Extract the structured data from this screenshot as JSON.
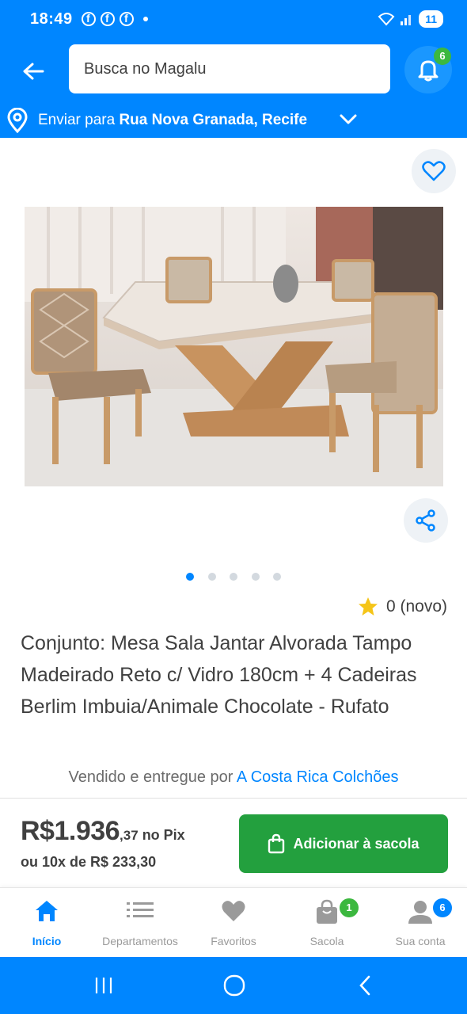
{
  "status_bar": {
    "time": "18:49",
    "battery_level": "11"
  },
  "header": {
    "search_placeholder": "Busca no Magalu",
    "notification_count": "6"
  },
  "address": {
    "prefix": "Enviar para ",
    "location": "Rua Nova Granada, Recife"
  },
  "product": {
    "carousel": {
      "total": 5,
      "active_index": 0
    },
    "rating_text": "0 (novo)",
    "title": "Conjunto: Mesa Sala Jantar Alvorada Tampo Madeirado Reto c/ Vidro 180cm + 4 Cadeiras Berlim Imbuia/Animale Chocolate - Rufato",
    "seller_prefix": "Vendido e entregue por ",
    "seller_name": "A Costa Rica Colchões"
  },
  "price": {
    "main": "R$1.936",
    "cents": ",37",
    "method": " no Pix",
    "installments": "ou 10x de R$ 233,30"
  },
  "cta": {
    "label": "Adicionar à sacola"
  },
  "bottom_nav": {
    "items": [
      {
        "label": "Início"
      },
      {
        "label": "Departamentos"
      },
      {
        "label": "Favoritos"
      },
      {
        "label": "Sacola",
        "badge": "1"
      },
      {
        "label": "Sua conta",
        "badge": "6"
      }
    ]
  },
  "colors": {
    "brand_blue": "#0086ff",
    "cta_green": "#23a03e",
    "badge_green": "#3cb83f",
    "star": "#f5c518"
  }
}
